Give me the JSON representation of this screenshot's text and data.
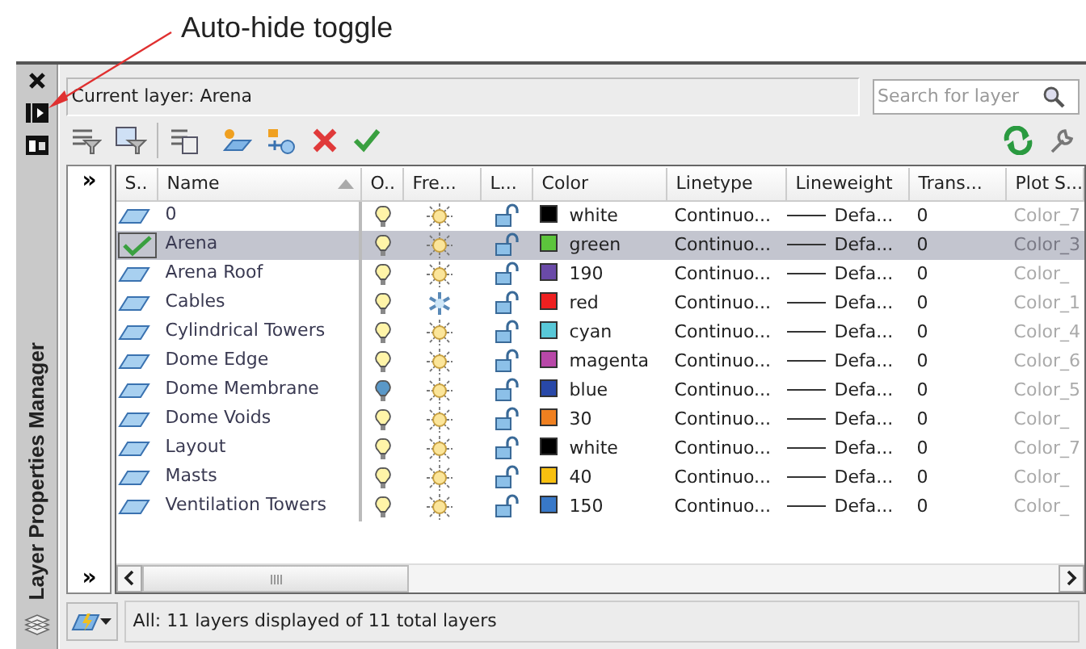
{
  "annotation": {
    "label": "Auto-hide toggle"
  },
  "side_panel": {
    "title": "Layer Properties Manager"
  },
  "current_layer": "Current layer: Arena",
  "search": {
    "placeholder": "Search for layer"
  },
  "filter_toggles": [
    "»",
    "»"
  ],
  "columns": [
    "S..",
    "Name",
    "O..",
    "Fre...",
    "L...",
    "Color",
    "Linetype",
    "Lineweight",
    "Trans...",
    "Plot S..."
  ],
  "layers": [
    {
      "name": "0",
      "selected": false,
      "current": false,
      "on": true,
      "frozen": false,
      "color_name": "white",
      "color": "#000000",
      "linetype": "Continuo...",
      "lineweight": "Defa...",
      "transparency": "0",
      "plot_style": "Color_7"
    },
    {
      "name": "Arena",
      "selected": true,
      "current": true,
      "on": true,
      "frozen": false,
      "color_name": "green",
      "color": "#5cc43c",
      "linetype": "Continuo...",
      "lineweight": "Defa...",
      "transparency": "0",
      "plot_style": "Color_3"
    },
    {
      "name": "Arena Roof",
      "selected": false,
      "current": false,
      "on": true,
      "frozen": false,
      "color_name": "190",
      "color": "#6a4aa8",
      "linetype": "Continuo...",
      "lineweight": "Defa...",
      "transparency": "0",
      "plot_style": "Color_"
    },
    {
      "name": "Cables",
      "selected": false,
      "current": false,
      "on": true,
      "frozen": true,
      "color_name": "red",
      "color": "#ee2020",
      "linetype": "Continuo...",
      "lineweight": "Defa...",
      "transparency": "0",
      "plot_style": "Color_1"
    },
    {
      "name": "Cylindrical Towers",
      "selected": false,
      "current": false,
      "on": true,
      "frozen": false,
      "color_name": "cyan",
      "color": "#58c8d8",
      "linetype": "Continuo...",
      "lineweight": "Defa...",
      "transparency": "0",
      "plot_style": "Color_4"
    },
    {
      "name": "Dome Edge",
      "selected": false,
      "current": false,
      "on": true,
      "frozen": false,
      "color_name": "magenta",
      "color": "#b848a8",
      "linetype": "Continuo...",
      "lineweight": "Defa...",
      "transparency": "0",
      "plot_style": "Color_6"
    },
    {
      "name": "Dome Membrane",
      "selected": false,
      "current": false,
      "on": false,
      "frozen": false,
      "color_name": "blue",
      "color": "#2848a8",
      "linetype": "Continuo...",
      "lineweight": "Defa...",
      "transparency": "0",
      "plot_style": "Color_5"
    },
    {
      "name": "Dome Voids",
      "selected": false,
      "current": false,
      "on": true,
      "frozen": false,
      "color_name": "30",
      "color": "#f08020",
      "linetype": "Continuo...",
      "lineweight": "Defa...",
      "transparency": "0",
      "plot_style": "Color_"
    },
    {
      "name": "Layout",
      "selected": false,
      "current": false,
      "on": true,
      "frozen": false,
      "color_name": "white",
      "color": "#000000",
      "linetype": "Continuo...",
      "lineweight": "Defa...",
      "transparency": "0",
      "plot_style": "Color_7"
    },
    {
      "name": "Masts",
      "selected": false,
      "current": false,
      "on": true,
      "frozen": false,
      "color_name": "40",
      "color": "#f8c010",
      "linetype": "Continuo...",
      "lineweight": "Defa...",
      "transparency": "0",
      "plot_style": "Color_"
    },
    {
      "name": "Ventilation Towers",
      "selected": false,
      "current": false,
      "on": true,
      "frozen": false,
      "color_name": "150",
      "color": "#3878c8",
      "linetype": "Continuo...",
      "lineweight": "Defa...",
      "transparency": "0",
      "plot_style": "Color_"
    }
  ],
  "status": "All: 11 layers displayed of 11 total layers"
}
